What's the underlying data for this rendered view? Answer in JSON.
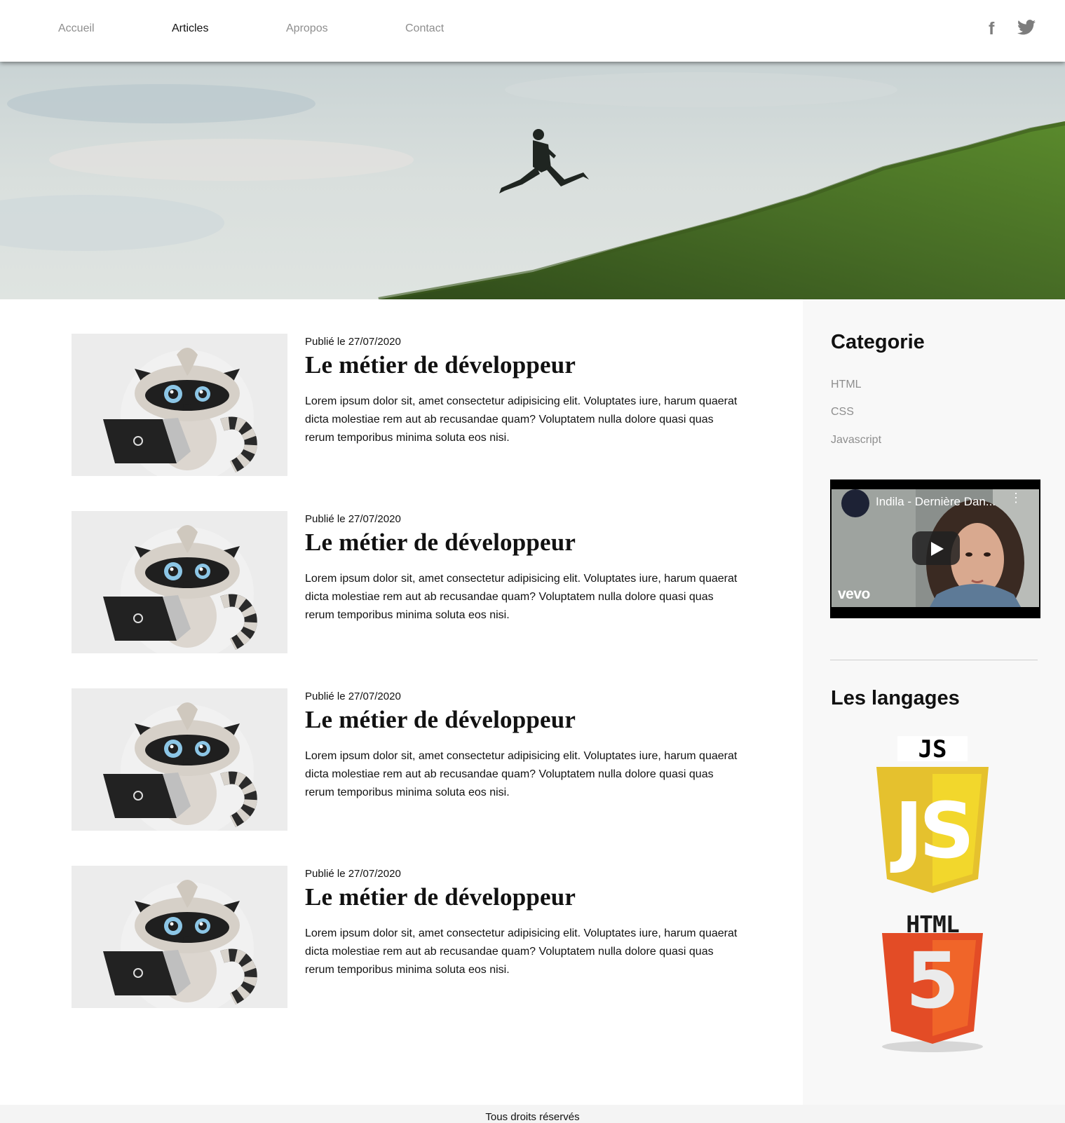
{
  "nav": {
    "items": [
      {
        "label": "Accueil",
        "active": false
      },
      {
        "label": "Articles",
        "active": true
      },
      {
        "label": "Apropos",
        "active": false
      },
      {
        "label": "Contact",
        "active": false
      }
    ],
    "social": [
      {
        "icon": "facebook-icon",
        "glyph": "f"
      },
      {
        "icon": "twitter-icon"
      }
    ],
    "colors": {
      "inactive": "#8e8e8e",
      "active": "#111111"
    }
  },
  "articles": [
    {
      "date": "Publié le 27/07/2020",
      "title": "Le métier de développeur",
      "excerpt": "Lorem ipsum dolor sit, amet consectetur adipisicing elit. Voluptates iure, harum quaerat dicta molestiae rem aut ab recusandae quam? Voluptatem nulla dolore quasi quas rerum temporibus minima soluta eos nisi."
    },
    {
      "date": "Publié le 27/07/2020",
      "title": "Le métier de développeur",
      "excerpt": "Lorem ipsum dolor sit, amet consectetur adipisicing elit. Voluptates iure, harum quaerat dicta molestiae rem aut ab recusandae quam? Voluptatem nulla dolore quasi quas rerum temporibus minima soluta eos nisi."
    },
    {
      "date": "Publié le 27/07/2020",
      "title": "Le métier de développeur",
      "excerpt": "Lorem ipsum dolor sit, amet consectetur adipisicing elit. Voluptates iure, harum quaerat dicta molestiae rem aut ab recusandae quam? Voluptatem nulla dolore quasi quas rerum temporibus minima soluta eos nisi."
    },
    {
      "date": "Publié le 27/07/2020",
      "title": "Le métier de développeur",
      "excerpt": "Lorem ipsum dolor sit, amet consectetur adipisicing elit. Voluptates iure, harum quaerat dicta molestiae rem aut ab recusandae quam? Voluptatem nulla dolore quasi quas rerum temporibus minima soluta eos nisi."
    }
  ],
  "sidebar": {
    "category_title": "Categorie",
    "categories": [
      "HTML",
      "CSS",
      "Javascript"
    ],
    "video": {
      "title": "Indila - Dernière Dan...",
      "brand": "vevo"
    },
    "languages_title": "Les langages",
    "logos": {
      "js_label": "JS",
      "js_shield": "JS",
      "html_label": "HTML",
      "html_shield": "5"
    }
  },
  "footer": {
    "text": "Tous droits réservés"
  }
}
